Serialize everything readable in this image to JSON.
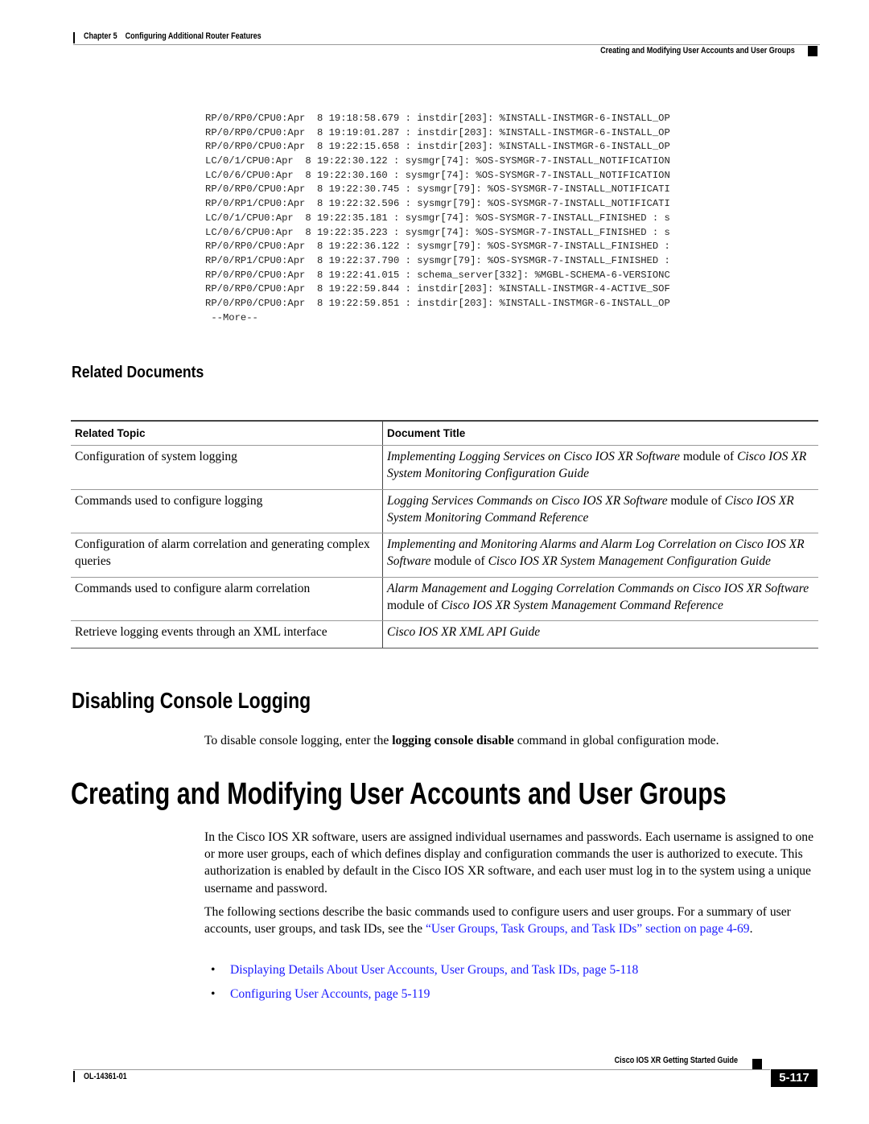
{
  "header": {
    "chapter": "Chapter 5",
    "chapter_title": "Configuring Additional Router Features",
    "section_title": "Creating and Modifying User Accounts and User Groups"
  },
  "log_output": {
    "lines": [
      "RP/0/RP0/CPU0:Apr  8 19:18:58.679 : instdir[203]: %INSTALL-INSTMGR-6-INSTALL_OP",
      "RP/0/RP0/CPU0:Apr  8 19:19:01.287 : instdir[203]: %INSTALL-INSTMGR-6-INSTALL_OP",
      "RP/0/RP0/CPU0:Apr  8 19:22:15.658 : instdir[203]: %INSTALL-INSTMGR-6-INSTALL_OP",
      "LC/0/1/CPU0:Apr  8 19:22:30.122 : sysmgr[74]: %OS-SYSMGR-7-INSTALL_NOTIFICATION",
      "LC/0/6/CPU0:Apr  8 19:22:30.160 : sysmgr[74]: %OS-SYSMGR-7-INSTALL_NOTIFICATION",
      "RP/0/RP0/CPU0:Apr  8 19:22:30.745 : sysmgr[79]: %OS-SYSMGR-7-INSTALL_NOTIFICATI",
      "RP/0/RP1/CPU0:Apr  8 19:22:32.596 : sysmgr[79]: %OS-SYSMGR-7-INSTALL_NOTIFICATI",
      "LC/0/1/CPU0:Apr  8 19:22:35.181 : sysmgr[74]: %OS-SYSMGR-7-INSTALL_FINISHED : s",
      "LC/0/6/CPU0:Apr  8 19:22:35.223 : sysmgr[74]: %OS-SYSMGR-7-INSTALL_FINISHED : s",
      "RP/0/RP0/CPU0:Apr  8 19:22:36.122 : sysmgr[79]: %OS-SYSMGR-7-INSTALL_FINISHED :",
      "RP/0/RP1/CPU0:Apr  8 19:22:37.790 : sysmgr[79]: %OS-SYSMGR-7-INSTALL_FINISHED :",
      "RP/0/RP0/CPU0:Apr  8 19:22:41.015 : schema_server[332]: %MGBL-SCHEMA-6-VERSIONC",
      "RP/0/RP0/CPU0:Apr  8 19:22:59.844 : instdir[203]: %INSTALL-INSTMGR-4-ACTIVE_SOF",
      "RP/0/RP0/CPU0:Apr  8 19:22:59.851 : instdir[203]: %INSTALL-INSTMGR-6-INSTALL_OP",
      " --More--"
    ]
  },
  "related_documents": {
    "heading": "Related Documents",
    "columns": [
      "Related Topic",
      "Document Title"
    ],
    "rows": [
      {
        "topic": "Configuration of system logging",
        "title_parts": [
          {
            "text": "Implementing Logging Services on Cisco IOS XR Software",
            "italic": true
          },
          {
            "text": " module of ",
            "italic": false
          },
          {
            "text": "Cisco IOS XR System Monitoring Configuration Guide",
            "italic": true
          }
        ]
      },
      {
        "topic": "Commands used to configure logging",
        "title_parts": [
          {
            "text": "Logging Services Commands on Cisco IOS XR Software",
            "italic": true
          },
          {
            "text": " module of ",
            "italic": false
          },
          {
            "text": "Cisco IOS XR System Monitoring Command Reference",
            "italic": true
          }
        ]
      },
      {
        "topic": "Configuration of alarm correlation and generating complex queries",
        "title_parts": [
          {
            "text": "Implementing and Monitoring Alarms and Alarm Log Correlation on Cisco IOS XR Software",
            "italic": true
          },
          {
            "text": " module of ",
            "italic": false
          },
          {
            "text": "Cisco IOS XR System Management Configuration Guide",
            "italic": true
          }
        ]
      },
      {
        "topic": "Commands used to configure alarm correlation",
        "title_parts": [
          {
            "text": "Alarm Management and Logging Correlation Commands on Cisco IOS XR Software",
            "italic": true
          },
          {
            "text": " module of ",
            "italic": false
          },
          {
            "text": "Cisco IOS XR System Management Command Reference",
            "italic": true
          }
        ]
      },
      {
        "topic": "Retrieve logging events through an XML interface",
        "title_parts": [
          {
            "text": "Cisco IOS XR XML API Guide",
            "italic": true
          }
        ]
      }
    ]
  },
  "disabling_console": {
    "heading": "Disabling Console Logging",
    "text_before": "To disable console logging, enter the ",
    "command": "logging console disable",
    "text_after": " command in global configuration mode."
  },
  "user_accounts": {
    "heading": "Creating and Modifying User Accounts and User Groups",
    "paragraph1": "In the Cisco IOS XR software, users are assigned individual usernames and passwords. Each username is assigned to one or more user groups, each of which defines display and configuration commands the user is authorized to execute. This authorization is enabled by default in the Cisco IOS XR software, and each user must log in to the system using a unique username and password.",
    "paragraph2_before": "The following sections describe the basic commands used to configure users and user groups. For a summary of user accounts, user groups, and task IDs, see the ",
    "paragraph2_link": "“User Groups, Task Groups, and Task IDs” section on page 4-69",
    "paragraph2_after": ".",
    "bullets": [
      "Displaying Details About User Accounts, User Groups, and Task IDs, page 5-118",
      "Configuring User Accounts, page 5-119"
    ],
    "bullet_glyph": "•"
  },
  "footer": {
    "guide_title": "Cisco IOS XR Getting Started Guide",
    "doc_number": "OL-14361-01",
    "page_number": "5-117"
  },
  "colors": {
    "link": "#1a1aff",
    "text": "#000000"
  }
}
